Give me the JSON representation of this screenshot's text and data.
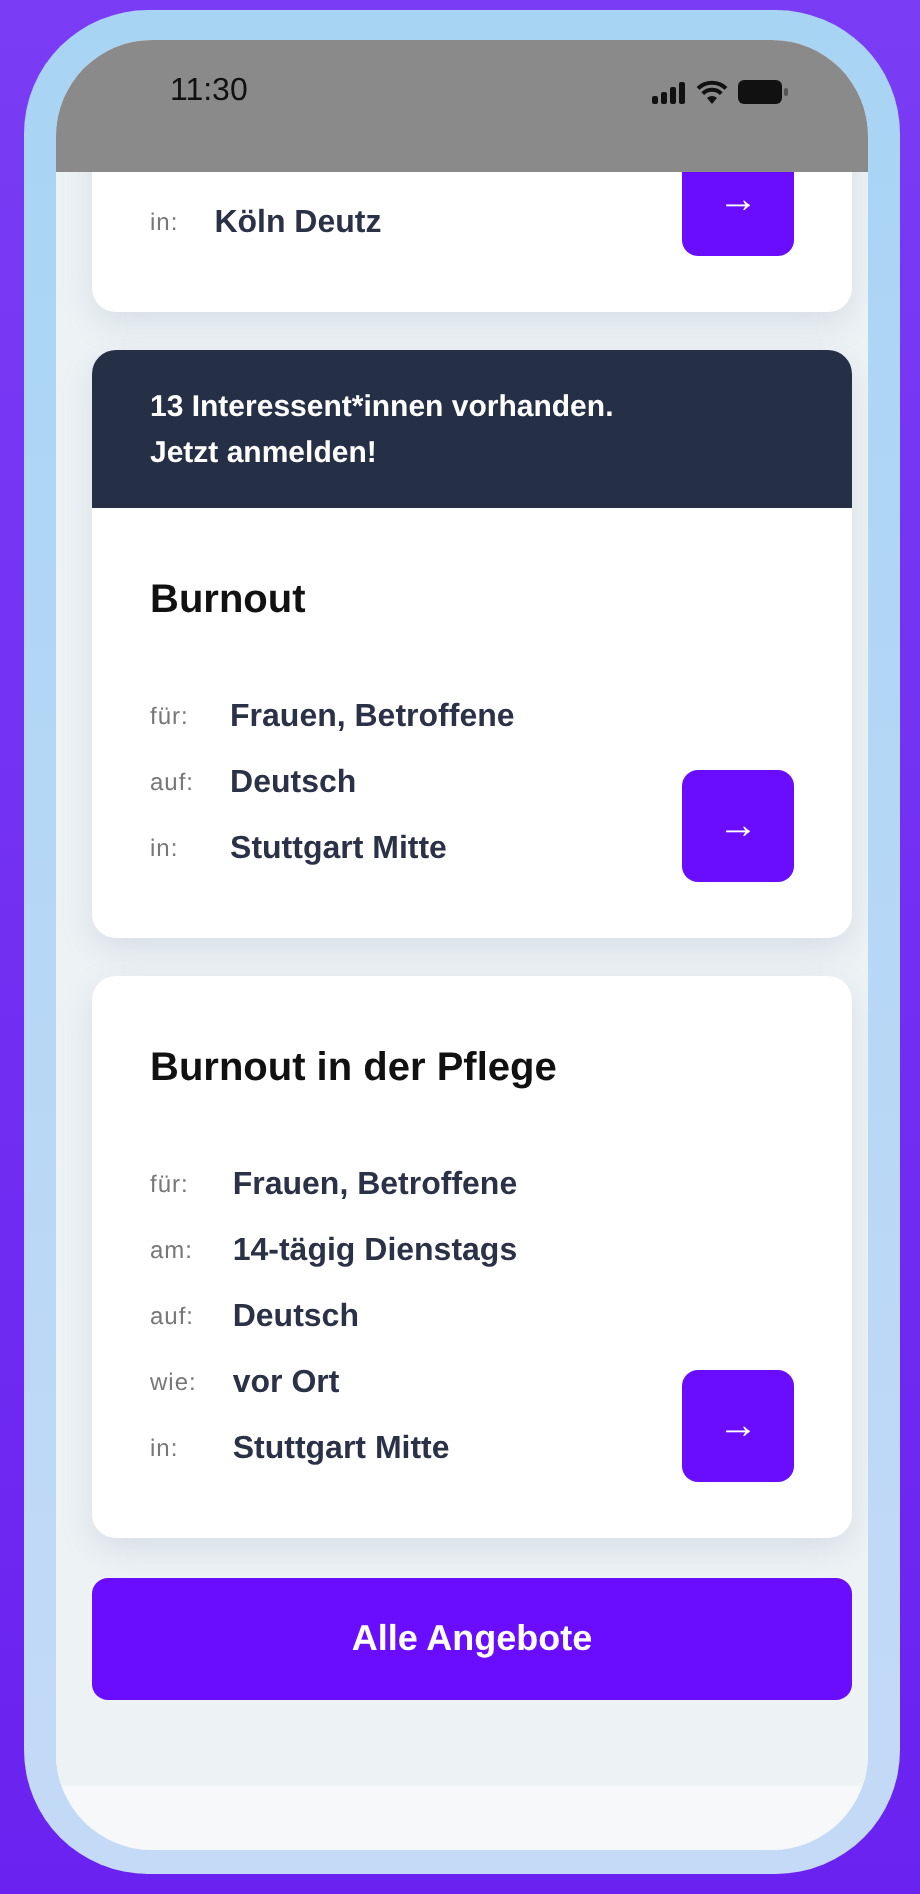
{
  "status_bar": {
    "time": "11:30"
  },
  "offers": [
    {
      "rows": [
        {
          "label": "in:",
          "value": "Köln Deutz"
        }
      ],
      "action": "→"
    },
    {
      "banner": "13 Interessent*innen vorhanden.\nJetzt anmelden!",
      "title": "Burnout",
      "rows": [
        {
          "label": "für:",
          "value": "Frauen, Betroffene"
        },
        {
          "label": "auf:",
          "value": "Deutsch"
        },
        {
          "label": "in:",
          "value": "Stuttgart Mitte"
        }
      ],
      "action": "→"
    },
    {
      "title": "Burnout in der Pflege",
      "rows": [
        {
          "label": "für:",
          "value": "Frauen, Betroffene"
        },
        {
          "label": "am:",
          "value": "14-tägig Dienstags"
        },
        {
          "label": "auf:",
          "value": "Deutsch"
        },
        {
          "label": "wie:",
          "value": "vor Ort"
        },
        {
          "label": "in:",
          "value": "Stuttgart Mitte"
        }
      ],
      "action": "→"
    }
  ],
  "all_button": "Alle Angebote"
}
